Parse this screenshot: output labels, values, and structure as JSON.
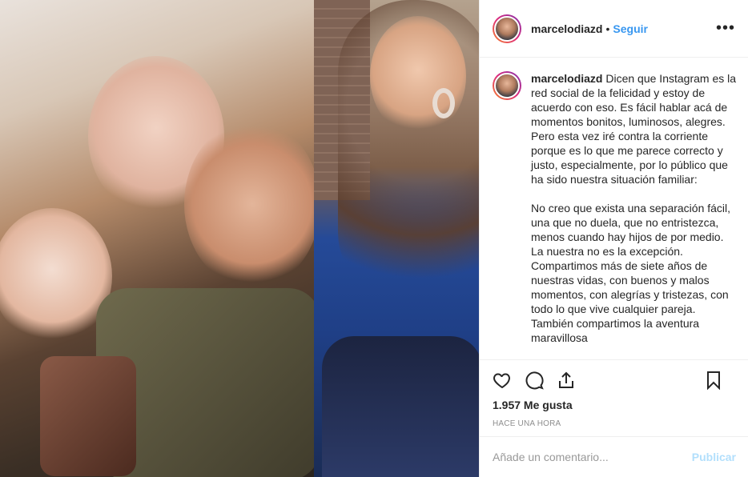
{
  "post": {
    "username": "marcelodiazd",
    "separator": "•",
    "follow_label": "Seguir",
    "more_label": "•••",
    "caption_p1": "Dicen que Instagram es la red social de la felicidad y estoy de acuerdo con eso. Es fácil hablar acá de momentos bonitos, luminosos, alegres. Pero esta vez iré contra la corriente porque es lo que me parece correcto y justo, especialmente, por lo público que ha sido nuestra situación familiar:",
    "caption_p2": "No creo que exista una separación fácil, una que no duela, que no entristezca, menos cuando hay hijos de por medio. La nuestra no es la excepción. Compartimos más de siete años de nuestras vidas, con buenos y malos momentos, con alegrías y tristezas, con todo lo que vive cualquier pareja. También compartimos la aventura maravillosa",
    "likes": "1.957 Me gusta",
    "time": "HACE UNA HORA",
    "comment_placeholder": "Añade un comentario...",
    "publish_label": "Publicar"
  },
  "icons": {
    "like": "heart-icon",
    "comment": "comment-icon",
    "share": "share-icon",
    "save": "bookmark-icon",
    "more": "more-dots-icon"
  },
  "colors": {
    "link": "#3897f0",
    "publish_disabled": "#b2dffc",
    "muted": "#8e8e8e",
    "border": "#efefef"
  }
}
